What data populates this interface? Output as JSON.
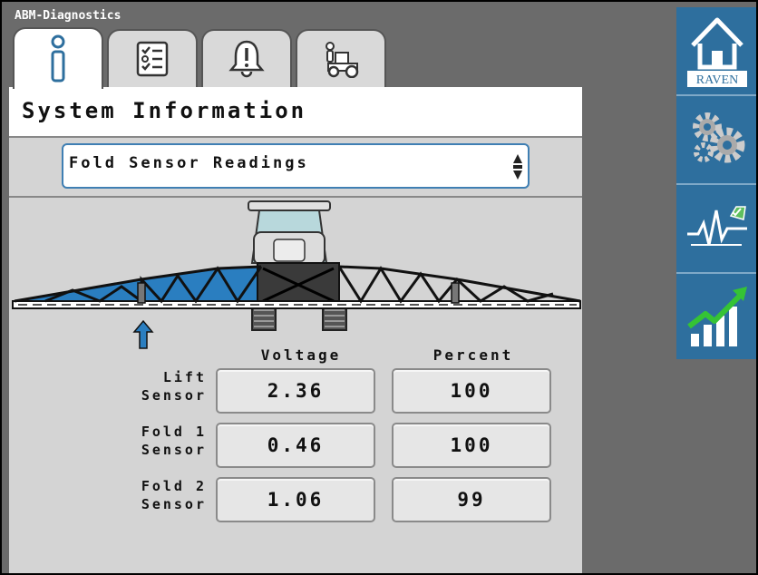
{
  "app": {
    "title": "ABM-Diagnostics"
  },
  "tabs": [
    {
      "name": "info",
      "icon": "info-icon",
      "active": true
    },
    {
      "name": "checklist",
      "icon": "checklist-icon",
      "active": false
    },
    {
      "name": "alarms",
      "icon": "alarm-bell-icon",
      "active": false
    },
    {
      "name": "machine",
      "icon": "tractor-icon",
      "active": false
    }
  ],
  "header": {
    "title": "System Information"
  },
  "selector": {
    "value": "Fold Sensor Readings"
  },
  "table": {
    "columns": [
      "Voltage",
      "Percent"
    ],
    "rows": [
      {
        "label_line1": "Lift",
        "label_line2": "Sensor",
        "voltage": "2.36",
        "percent": "100"
      },
      {
        "label_line1": "Fold 1",
        "label_line2": "Sensor",
        "voltage": "0.46",
        "percent": "100"
      },
      {
        "label_line1": "Fold 2",
        "label_line2": "Sensor",
        "voltage": "1.06",
        "percent": "99"
      }
    ]
  },
  "sidebar": {
    "brand": "RAVEN",
    "items": [
      {
        "icon": "home-icon"
      },
      {
        "icon": "gears-icon"
      },
      {
        "icon": "diagnostics-icon"
      },
      {
        "icon": "performance-chart-icon"
      }
    ]
  },
  "colors": {
    "accent": "#2e6f9e",
    "boom_highlight": "#2a7ec0",
    "panel": "#d4d4d4",
    "frame": "#6b6b6b"
  }
}
